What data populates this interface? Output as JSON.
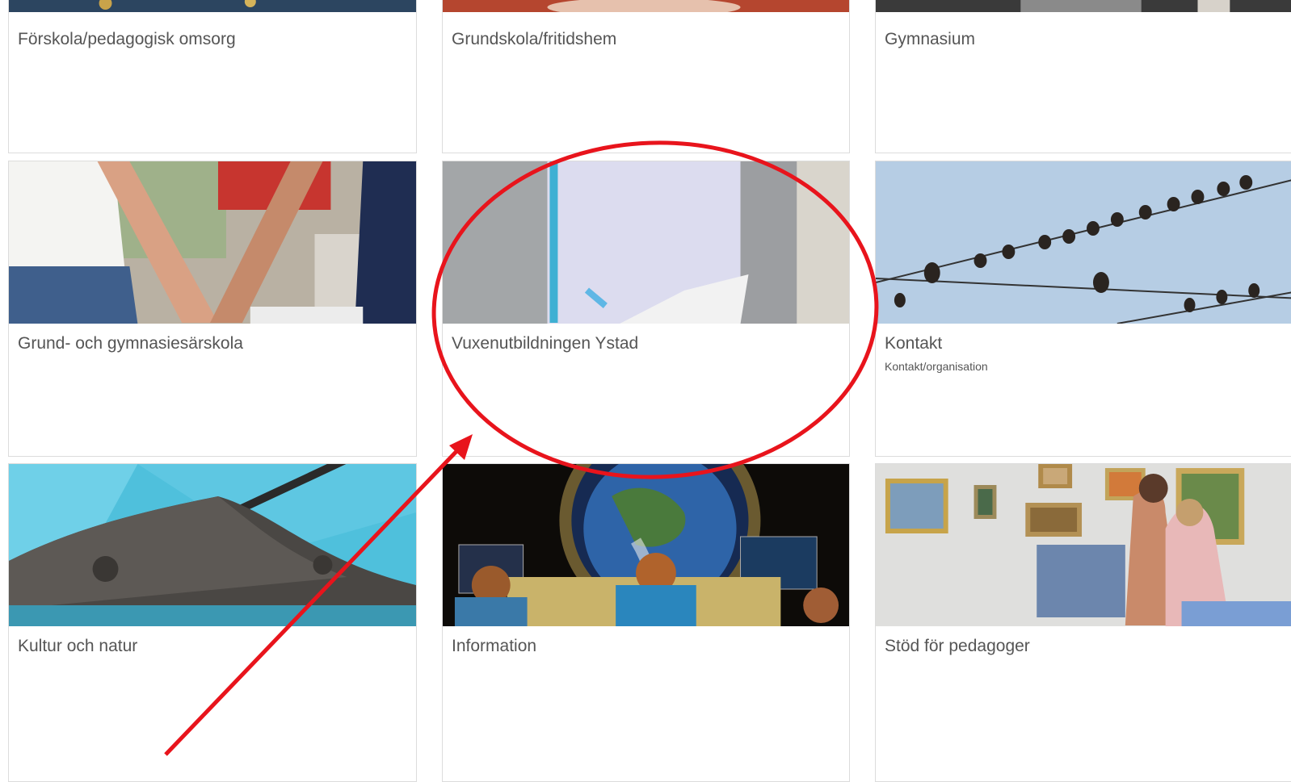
{
  "cards": [
    {
      "title": "Förskola/pedagogisk omsorg"
    },
    {
      "title": "Grundskola/fritidshem"
    },
    {
      "title": "Gymnasium"
    },
    {
      "title": "Grund- och gymnasiesärskola"
    },
    {
      "title": "Vuxenutbildningen Ystad"
    },
    {
      "title": "Kontakt",
      "subtitle": "Kontakt/organisation"
    },
    {
      "title": "Kultur och natur"
    },
    {
      "title": "Information"
    },
    {
      "title": "Stöd för pedagoger"
    }
  ],
  "annotation": {
    "color": "#e8141c"
  }
}
